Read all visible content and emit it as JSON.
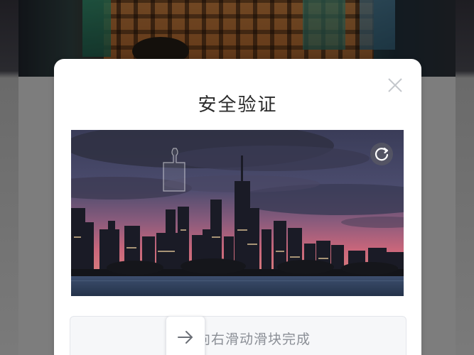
{
  "dialog": {
    "title": "安全验证",
    "close_icon": "close-icon",
    "refresh_icon": "refresh-icon",
    "puzzle_image": "city-skyline-night"
  },
  "slider": {
    "hint": "向右滑动滑块完成",
    "handle_icon": "arrow-right-icon"
  },
  "colors": {
    "overlay": "#7d7d7d",
    "dialog_bg": "#ffffff",
    "title_text": "#2b2b2b",
    "hint_text": "#8b8f96"
  }
}
